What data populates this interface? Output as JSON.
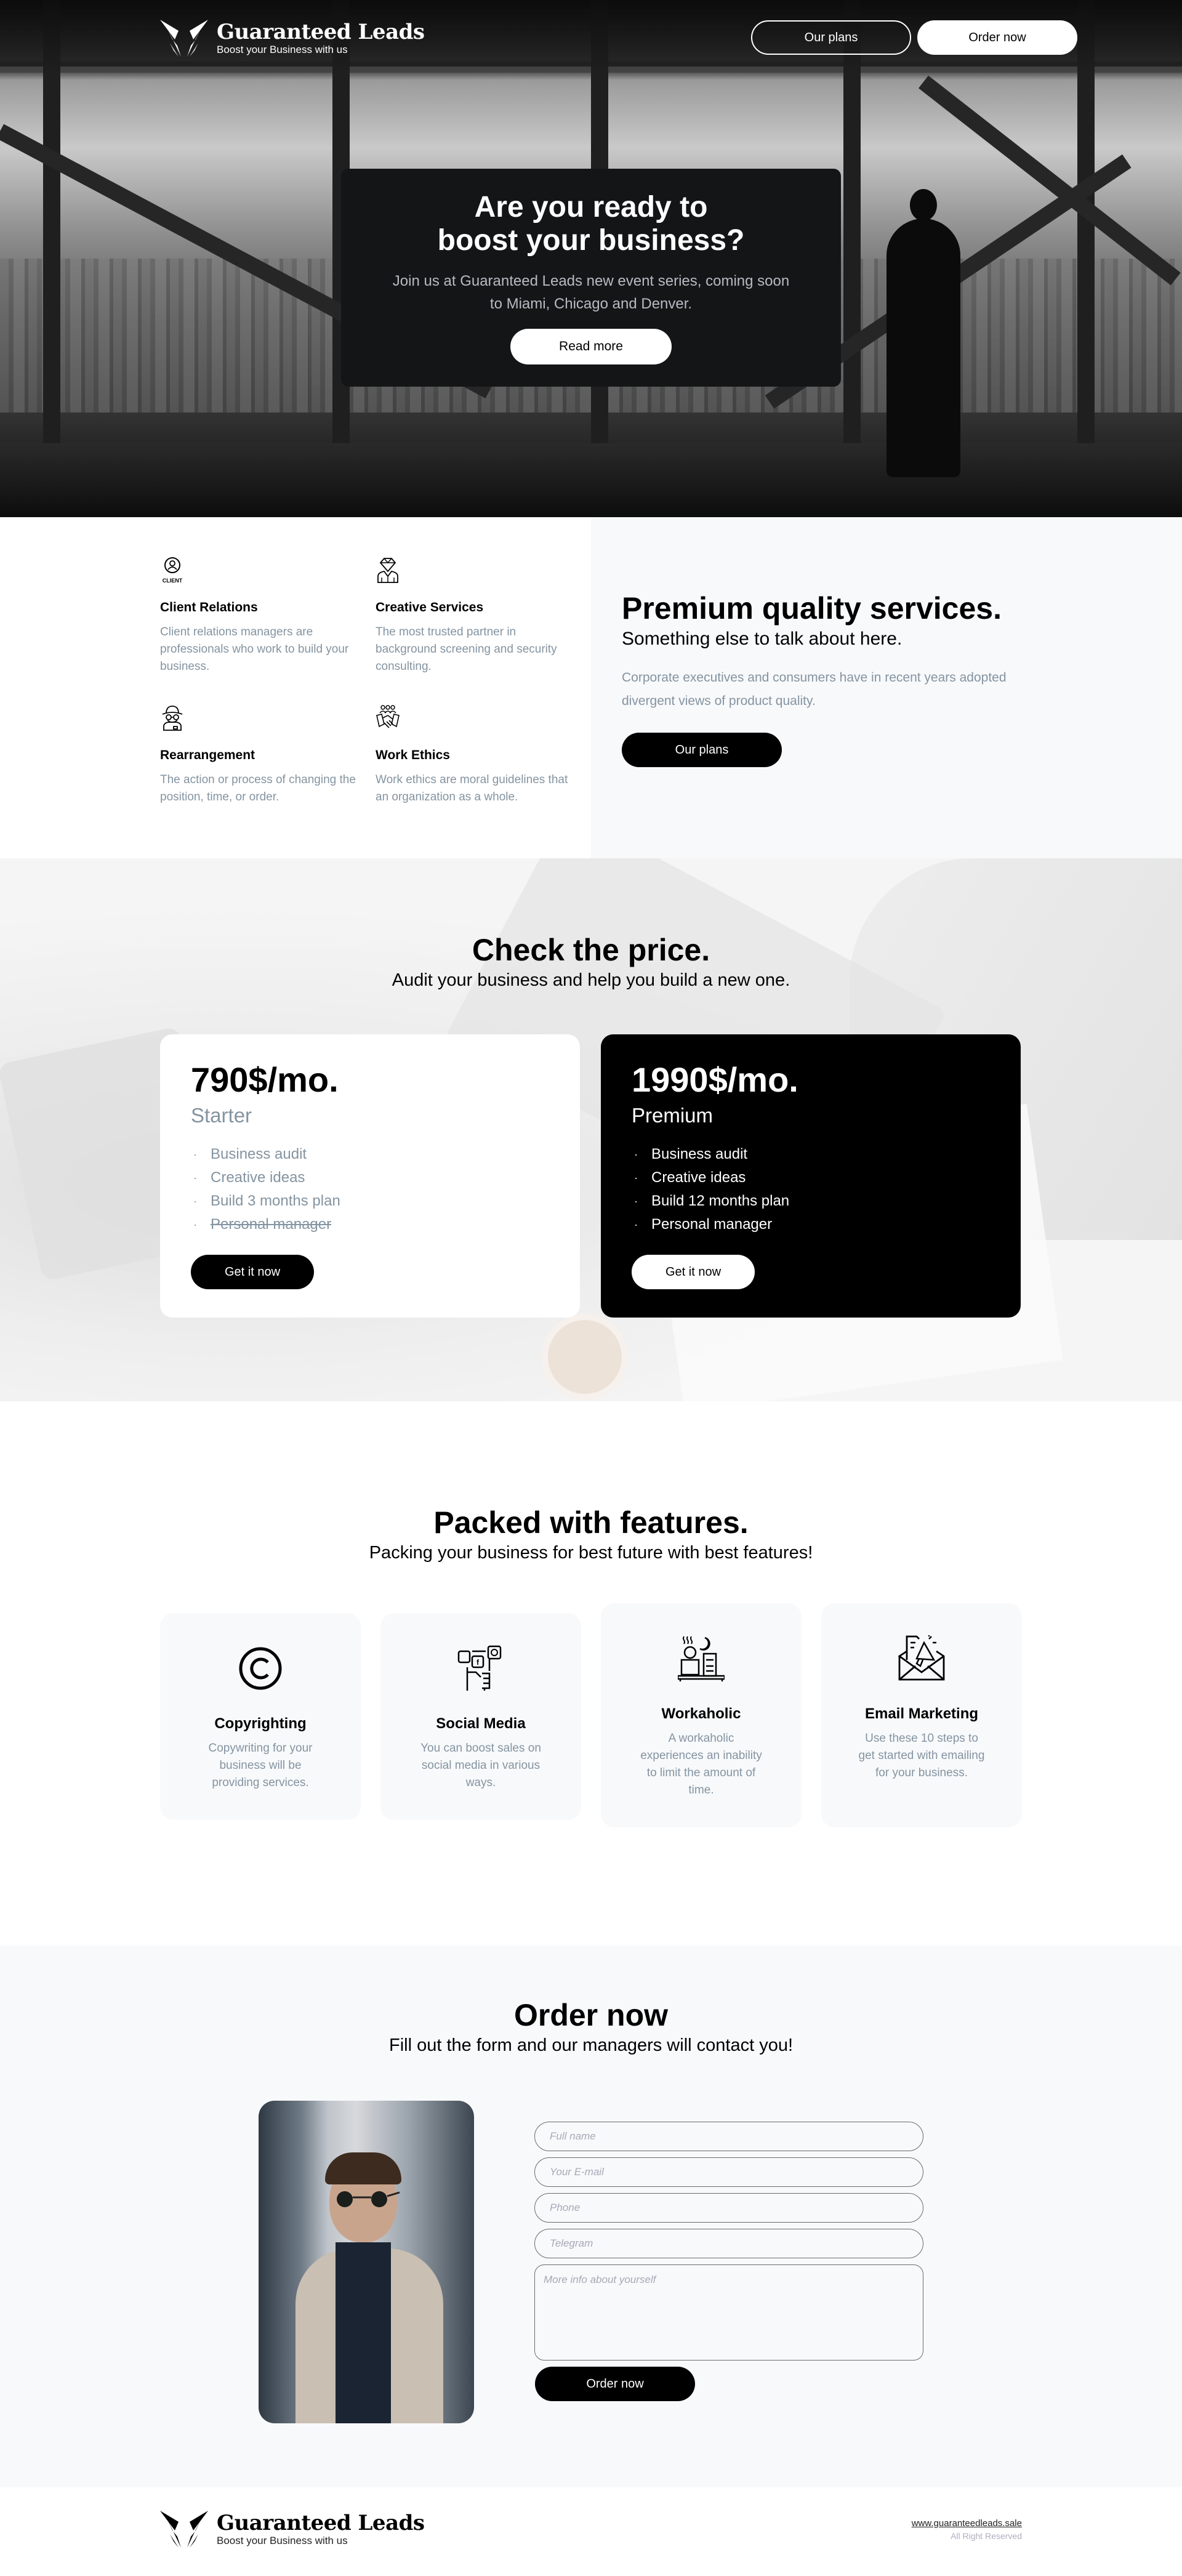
{
  "brand": {
    "name": "Guaranteed Leads",
    "tagline": "Boost your Business with us"
  },
  "nav": {
    "plans_label": "Our plans",
    "order_label": "Order now"
  },
  "hero": {
    "title_line1": "Are you ready to",
    "title_line2": "boost your business?",
    "description_line1": "Join us at Guaranteed Leads new event series, coming soon",
    "description_line2": "to Miami, Chicago and Denver.",
    "button_label": "Read more"
  },
  "services": {
    "items": [
      {
        "icon": "client-icon",
        "icon_caption": "CLIENT",
        "title": "Client Relations",
        "description": "Client relations managers are professionals who work to build your business."
      },
      {
        "icon": "diamond-businessman-icon",
        "title": "Creative Services",
        "description": "The most trusted partner in background screening and security consulting."
      },
      {
        "icon": "detective-icon",
        "title": "Rearrangement",
        "description": "The action or process of changing the position, time, or order."
      },
      {
        "icon": "handshake-team-icon",
        "title": "Work Ethics",
        "description": "Work ethics are moral guidelines that an organization as a whole."
      }
    ],
    "premium": {
      "title": "Premium quality services.",
      "subtitle": "Something else to talk about here.",
      "description": "Corporate executives and consumers have in recent years adopted divergent views of product quality.",
      "button_label": "Our plans"
    }
  },
  "pricing": {
    "title": "Check the price.",
    "subtitle": "Audit your business and help you build a new one.",
    "plans": [
      {
        "price": "790$/mo.",
        "name": "Starter",
        "features": [
          {
            "text": "Business audit",
            "included": true
          },
          {
            "text": "Creative ideas",
            "included": true
          },
          {
            "text": "Build 3 months plan",
            "included": true
          },
          {
            "text": "Personal manager",
            "included": false
          }
        ],
        "button_label": "Get it now"
      },
      {
        "price": "1990$/mo.",
        "name": "Premium",
        "features": [
          {
            "text": "Business audit",
            "included": true
          },
          {
            "text": "Creative ideas",
            "included": true
          },
          {
            "text": "Build 12 months plan",
            "included": true
          },
          {
            "text": "Personal manager",
            "included": true
          }
        ],
        "button_label": "Get it now"
      }
    ],
    "bullet": "·"
  },
  "features": {
    "title": "Packed with features.",
    "subtitle": "Packing your business for best future with best features!",
    "items": [
      {
        "icon": "copyright-icon",
        "title": "Copyrighting",
        "description": "Copywriting for your business will be providing services."
      },
      {
        "icon": "social-media-icon",
        "title": "Social Media",
        "description": "You can boost sales on social media in various ways."
      },
      {
        "icon": "workaholic-icon",
        "title": "Workaholic",
        "description": "A workaholic experiences an inability to limit the amount of time."
      },
      {
        "icon": "email-marketing-icon",
        "title": "Email Marketing",
        "description": "Use these 10 steps to get started with emailing for your business."
      }
    ]
  },
  "order": {
    "title": "Order now",
    "subtitle": "Fill out the form and our managers will contact you!",
    "fields": {
      "full_name": {
        "placeholder": "Full name",
        "value": ""
      },
      "email": {
        "placeholder": "Your E-mail",
        "value": ""
      },
      "phone": {
        "placeholder": "Phone",
        "value": ""
      },
      "telegram": {
        "placeholder": "Telegram",
        "value": ""
      },
      "info": {
        "placeholder": "More info about yourself",
        "value": ""
      }
    },
    "submit_label": "Order now"
  },
  "footer": {
    "url": "www.guaranteedleads.sale",
    "rights": "All Right Reserved"
  },
  "colors": {
    "accent": "#000000",
    "muted_text": "#8494a1",
    "light_bg": "#f8f9fb",
    "hero_card": "#141517",
    "placeholder": "#a9a7b7"
  }
}
